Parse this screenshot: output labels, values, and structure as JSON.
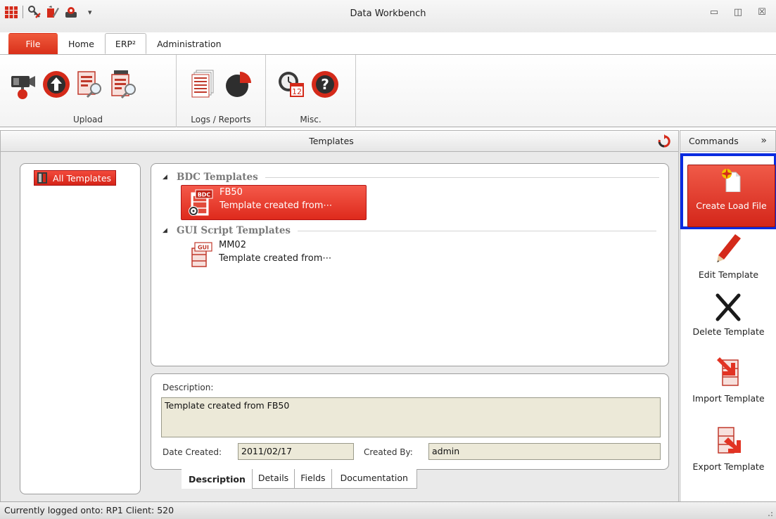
{
  "window": {
    "title": "Data Workbench"
  },
  "quick_access": {
    "icons": [
      "apps-grid-icon",
      "connect-key-icon",
      "edit-tools-icon",
      "logon-icon"
    ],
    "dropdown_glyph": "▾"
  },
  "window_controls": {
    "minimize": "▭",
    "maximize": "◫",
    "close": "☒"
  },
  "ribbon": {
    "tabs": [
      {
        "label": "File"
      },
      {
        "label": "Home"
      },
      {
        "label": "ERP²"
      },
      {
        "label": "Administration"
      }
    ],
    "active_tab": "ERP²",
    "groups": {
      "upload": "Upload",
      "logs_reports": "Logs / Reports",
      "misc": "Misc."
    }
  },
  "templates_header": {
    "title": "Templates"
  },
  "commands_header": {
    "title": "Commands",
    "chevron": "»"
  },
  "tree": {
    "root_label": "All Templates"
  },
  "template_groups": [
    {
      "title": "BDC Templates",
      "items": [
        {
          "name": "FB50",
          "description": "Template created from⋯",
          "badge": "BDC",
          "selected": true
        }
      ]
    },
    {
      "title": "GUI Script Templates",
      "items": [
        {
          "name": "MM02",
          "description": "Template created from⋯",
          "badge": "GUI",
          "selected": false
        }
      ]
    }
  ],
  "details": {
    "description_label": "Description:",
    "description_value": "Template created from FB50",
    "date_created_label": "Date Created:",
    "date_created_value": "2011/02/17",
    "created_by_label": "Created By:",
    "created_by_value": "admin",
    "tabs": [
      "Description",
      "Details",
      "Fields",
      "Documentation"
    ],
    "active_tab": "Description"
  },
  "commands": {
    "create_load_file": "Create Load File",
    "edit_template": "Edit Template",
    "delete_template": "Delete Template",
    "import_template": "Import Template",
    "export_template": "Export Template"
  },
  "status": {
    "text": "Currently logged onto: RP1 Client: 520"
  },
  "colors": {
    "accent_red": "#e03322",
    "selection_frame_blue": "#0a2be0",
    "readonly_field_bg": "#ece9d8"
  }
}
